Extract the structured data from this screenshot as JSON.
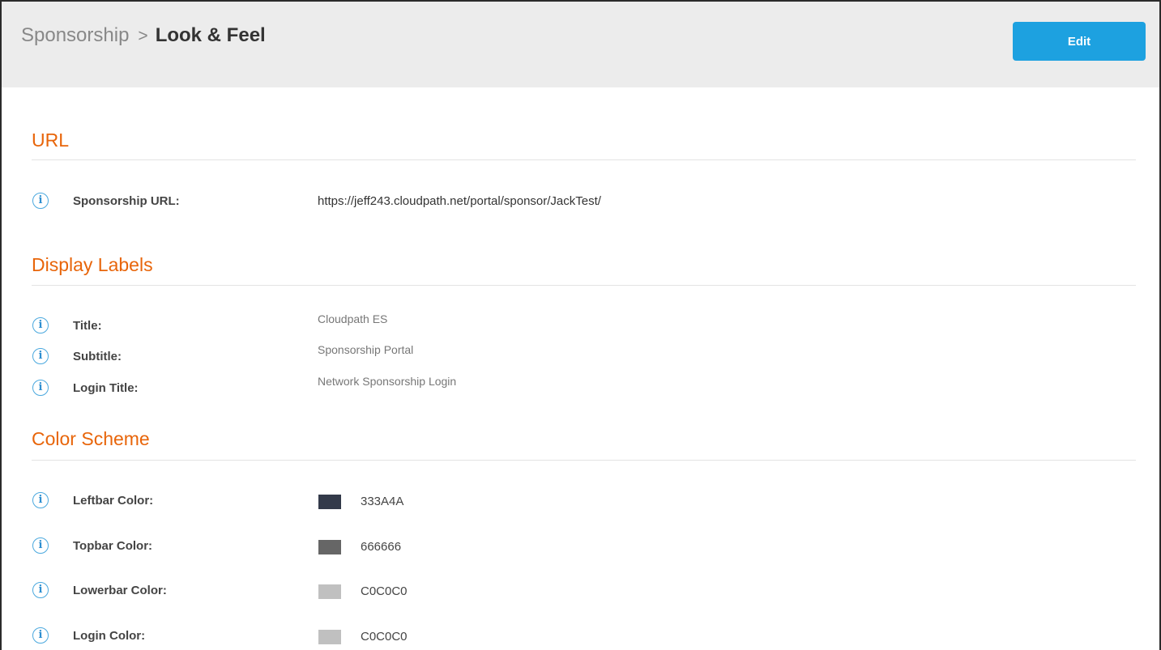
{
  "header": {
    "breadcrumb_parent": "Sponsorship",
    "breadcrumb_separator": ">",
    "breadcrumb_current": "Look & Feel",
    "edit_label": "Edit"
  },
  "info_icon_glyph": "i",
  "url_section": {
    "title": "URL",
    "rows": [
      {
        "label": "Sponsorship URL:",
        "value": "https://jeff243.cloudpath.net/portal/sponsor/JackTest/"
      }
    ]
  },
  "display_labels": {
    "title": "Display Labels",
    "rows": [
      {
        "label": "Title:",
        "value": "Cloudpath ES"
      },
      {
        "label": "Subtitle:",
        "value": "Sponsorship Portal"
      },
      {
        "label": "Login Title:",
        "value": "Network Sponsorship Login"
      }
    ]
  },
  "color_scheme": {
    "title": "Color Scheme",
    "rows": [
      {
        "label": "Leftbar Color:",
        "hex": "333A4A",
        "color": "#333A4A"
      },
      {
        "label": "Topbar Color:",
        "hex": "666666",
        "color": "#666666"
      },
      {
        "label": "Lowerbar Color:",
        "hex": "C0C0C0",
        "color": "#C0C0C0"
      },
      {
        "label": "Login Color:",
        "hex": "C0C0C0",
        "color": "#C0C0C0"
      }
    ]
  },
  "colors": {
    "accent": "#1da1e0",
    "section_title": "#e8650a",
    "header_bg": "#ececec"
  }
}
